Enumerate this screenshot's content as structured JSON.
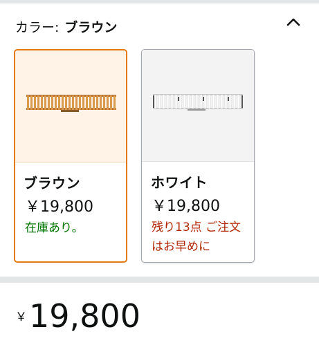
{
  "variation": {
    "label": "カラー:",
    "selected_value": "ブラウン",
    "collapse_icon": "chevron-up-icon"
  },
  "swatches": [
    {
      "name": "ブラウン",
      "price": "￥19,800",
      "availability": "在庫あり。",
      "selected": true,
      "image_color": "#c98a3c"
    },
    {
      "name": "ホワイト",
      "price": "￥19,800",
      "availability": "残り13点 ご注文はお早めに",
      "selected": false,
      "image_color": "#f4f4f4"
    }
  ],
  "price_block": {
    "currency_symbol": "￥",
    "amount": "19,800"
  },
  "colors": {
    "selected_border": "#e47911",
    "in_stock": "#007600",
    "low_stock": "#b12704"
  }
}
